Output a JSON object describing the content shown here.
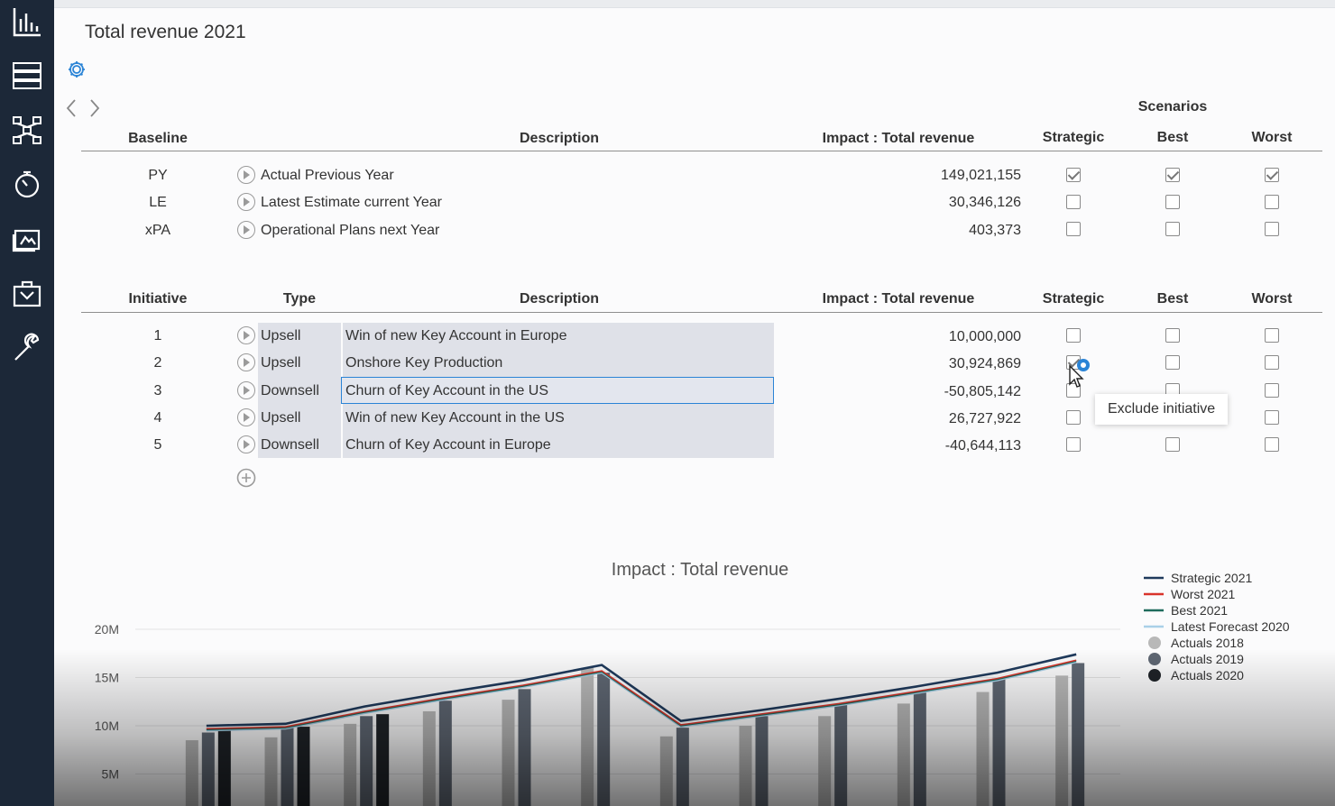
{
  "page": {
    "title": "Total revenue 2021"
  },
  "nav": [
    "chart-icon",
    "database-icon",
    "hierarchy-icon",
    "gauge-icon",
    "media-icon",
    "briefcase-icon",
    "wrench-icon"
  ],
  "scenarios_label": "Scenarios",
  "baseline": {
    "headers": {
      "col": "Baseline",
      "description": "Description",
      "impact": "Impact : Total revenue",
      "strategic": "Strategic",
      "best": "Best",
      "worst": "Worst"
    },
    "rows": [
      {
        "code": "PY",
        "description": "Actual Previous Year",
        "impact": "149,021,155",
        "strategic": true,
        "best": true,
        "worst": true
      },
      {
        "code": "LE",
        "description": "Latest Estimate current Year",
        "impact": "30,346,126",
        "strategic": false,
        "best": false,
        "worst": false
      },
      {
        "code": "xPA",
        "description": "Operational Plans next Year",
        "impact": "403,373",
        "strategic": false,
        "best": false,
        "worst": false
      }
    ]
  },
  "initiatives": {
    "headers": {
      "col": "Initiative",
      "type": "Type",
      "description": "Description",
      "impact": "Impact : Total revenue",
      "strategic": "Strategic",
      "best": "Best",
      "worst": "Worst"
    },
    "rows": [
      {
        "id": "1",
        "type": "Upsell",
        "description": "Win of new Key Account in Europe",
        "impact": "10,000,000",
        "strategic": false,
        "best": false,
        "worst": false
      },
      {
        "id": "2",
        "type": "Upsell",
        "description": "Onshore Key Production",
        "impact": "30,924,869",
        "strategic": true,
        "best": false,
        "worst": false
      },
      {
        "id": "3",
        "type": "Downsell",
        "description": "Churn of Key Account in the US",
        "impact": "-50,805,142",
        "strategic": false,
        "best": false,
        "worst": false
      },
      {
        "id": "4",
        "type": "Upsell",
        "description": "Win of new Key Account in the US",
        "impact": "26,727,922",
        "strategic": false,
        "best": false,
        "worst": false
      },
      {
        "id": "5",
        "type": "Downsell",
        "description": "Churn of Key Account in Europe",
        "impact": "-40,644,113",
        "strategic": false,
        "best": false,
        "worst": false
      }
    ]
  },
  "tooltip": "Exclude initiative",
  "colors": {
    "rail": "#1c2838",
    "strategic": "#1f3a5c",
    "worst": "#d9342b",
    "best": "#1e6b5c",
    "latest": "#a9d0e8",
    "a2018": "#b8b8b8",
    "a2019": "#5f6773",
    "a2020": "#1f2328"
  },
  "chart_data": {
    "type": "bar",
    "title": "Impact : Total revenue",
    "ylim": [
      0,
      21
    ],
    "yticks": [
      "20M",
      "15M",
      "10M",
      "5M"
    ],
    "ytick_values": [
      20,
      15,
      10,
      5
    ],
    "unit": "M",
    "periods": 12,
    "bars": [
      {
        "name": "Actuals 2018",
        "values": [
          8.5,
          8.8,
          10.2,
          11.5,
          12.7,
          16.0,
          8.9,
          10.0,
          11.0,
          12.3,
          13.5,
          15.2
        ]
      },
      {
        "name": "Actuals 2019",
        "values": [
          9.3,
          9.8,
          11.0,
          12.6,
          13.8,
          15.5,
          9.8,
          11.0,
          12.2,
          13.5,
          14.9,
          16.5
        ]
      },
      {
        "name": "Actuals 2020",
        "values": [
          9.5,
          9.9,
          11.2
        ]
      }
    ],
    "lines": [
      {
        "name": "Strategic 2021",
        "values": [
          10.0,
          10.2,
          12.0,
          13.4,
          14.7,
          16.3,
          10.5,
          11.6,
          12.8,
          14.1,
          15.5,
          17.4
        ]
      },
      {
        "name": "Worst 2021",
        "values": [
          9.7,
          9.9,
          11.5,
          12.9,
          14.2,
          15.7,
          10.1,
          11.2,
          12.3,
          13.6,
          14.9,
          16.8
        ]
      },
      {
        "name": "Best 2021",
        "values": [
          9.6,
          9.8,
          11.4,
          12.8,
          14.1,
          15.6,
          10.0,
          11.1,
          12.2,
          13.5,
          14.8,
          16.7
        ]
      },
      {
        "name": "Latest Forecast 2020",
        "values": [
          9.5,
          9.7,
          11.3,
          12.7,
          14.0,
          15.5,
          9.9,
          11.0,
          12.1,
          13.4,
          14.7,
          16.6
        ]
      }
    ],
    "legend_position": "top-right",
    "grid": true
  }
}
